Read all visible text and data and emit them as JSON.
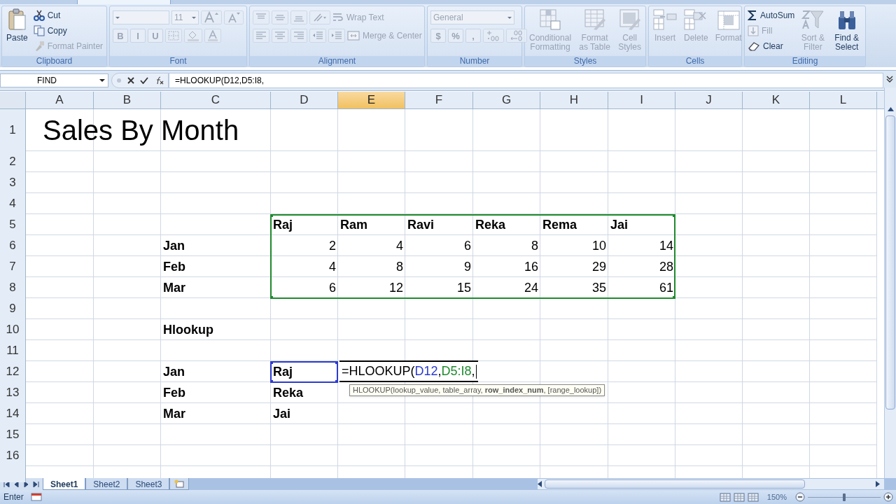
{
  "ribbon": {
    "groups": [
      {
        "label": "Clipboard",
        "lines": [
          [
            {
              "kind": "large",
              "label": "Paste",
              "disabled": false
            }
          ],
          [
            {
              "kind": "small",
              "label": "Cut",
              "disabled": false
            },
            {
              "kind": "small",
              "label": "Copy",
              "disabled": false
            },
            {
              "kind": "small",
              "label": "Format Painter",
              "disabled": true
            }
          ]
        ]
      },
      {
        "label": "Font",
        "lines": [
          [
            {
              "kind": "combo",
              "disabled": true
            },
            {
              "kind": "combo",
              "value": "11",
              "disabled": true
            },
            {
              "kind": "icon",
              "disabled": true
            },
            {
              "kind": "icon",
              "disabled": true
            }
          ],
          [
            {
              "kind": "glyph",
              "label": "B",
              "disabled": true
            },
            {
              "kind": "glyph",
              "label": "I",
              "disabled": true
            },
            {
              "kind": "glyph",
              "label": "U",
              "disabled": true
            },
            {
              "kind": "icon",
              "disabled": true
            },
            {
              "kind": "icon",
              "disabled": true
            },
            {
              "kind": "icon",
              "disabled": true
            }
          ]
        ]
      },
      {
        "label": "Alignment",
        "lines": [
          [
            {
              "kind": "icon",
              "disabled": true
            },
            {
              "kind": "icon",
              "disabled": true
            },
            {
              "kind": "icon",
              "disabled": true
            },
            {
              "kind": "icon",
              "disabled": true
            },
            {
              "kind": "small",
              "label": "Wrap Text",
              "disabled": true
            }
          ],
          [
            {
              "kind": "icon",
              "disabled": true
            },
            {
              "kind": "icon",
              "disabled": true
            },
            {
              "kind": "icon",
              "disabled": true
            },
            {
              "kind": "icon",
              "disabled": true
            },
            {
              "kind": "icon",
              "disabled": true
            },
            {
              "kind": "small",
              "label": "Merge & Center",
              "disabled": true
            }
          ]
        ]
      },
      {
        "label": "Number",
        "lines": [
          [
            {
              "kind": "combo",
              "value": "General",
              "disabled": true
            }
          ],
          [
            {
              "kind": "glyph",
              "label": "$",
              "disabled": true
            },
            {
              "kind": "glyph",
              "label": "%",
              "disabled": true
            },
            {
              "kind": "glyph",
              "label": ",",
              "disabled": true
            },
            {
              "kind": "icon",
              "disabled": true
            },
            {
              "kind": "icon",
              "disabled": true
            }
          ]
        ]
      },
      {
        "label": "Styles",
        "lines": [
          [
            {
              "kind": "large",
              "label": "Conditional Formatting",
              "disabled": true
            }
          ],
          [
            {
              "kind": "large",
              "label": "Format as Table",
              "disabled": true
            }
          ],
          [
            {
              "kind": "large",
              "label": "Cell Styles",
              "disabled": true
            }
          ]
        ]
      },
      {
        "label": "Cells",
        "lines": [
          [
            {
              "kind": "large",
              "label": "Insert",
              "disabled": true
            }
          ],
          [
            {
              "kind": "large",
              "label": "Delete",
              "disabled": true
            }
          ],
          [
            {
              "kind": "large",
              "label": "Format",
              "disabled": true
            }
          ]
        ]
      },
      {
        "label": "Editing",
        "lines": [
          [
            {
              "kind": "small",
              "label": "AutoSum",
              "disabled": false
            },
            {
              "kind": "small",
              "label": "Fill",
              "disabled": true
            },
            {
              "kind": "small",
              "label": "Clear",
              "disabled": false
            }
          ],
          [
            {
              "kind": "large",
              "label": "Sort & Filter",
              "disabled": true
            }
          ],
          [
            {
              "kind": "large",
              "label": "Find & Select",
              "disabled": false
            }
          ]
        ]
      }
    ]
  },
  "formula_bar": {
    "name_box": "FIND",
    "formula": "=HLOOKUP(D12,D5:I8,"
  },
  "columns": [
    {
      "label": "A",
      "selected": false
    },
    {
      "label": "B",
      "selected": false
    },
    {
      "label": "C",
      "selected": false
    },
    {
      "label": "D",
      "selected": false
    },
    {
      "label": "E",
      "selected": true
    },
    {
      "label": "F",
      "selected": false
    },
    {
      "label": "G",
      "selected": false
    },
    {
      "label": "H",
      "selected": false
    },
    {
      "label": "I",
      "selected": false
    },
    {
      "label": "J",
      "selected": false
    },
    {
      "label": "K",
      "selected": false
    },
    {
      "label": "L",
      "selected": false
    }
  ],
  "rows": [
    {
      "number": "1",
      "cells": [
        {
          "kind": "title",
          "text": "Sales By Month"
        }
      ]
    },
    {
      "number": "2"
    },
    {
      "number": "3"
    },
    {
      "number": "4"
    },
    {
      "number": "5",
      "cells": [
        {},
        {},
        {},
        {
          "kind": "label",
          "text": "Raj"
        },
        {
          "kind": "label",
          "text": "Ram"
        },
        {
          "kind": "label",
          "text": "Ravi"
        },
        {
          "kind": "label",
          "text": "Reka"
        },
        {
          "kind": "label",
          "text": "Rema"
        },
        {
          "kind": "label",
          "text": "Jai"
        }
      ]
    },
    {
      "number": "6",
      "cells": [
        {},
        {},
        {
          "kind": "label",
          "text": "Jan"
        },
        {
          "kind": "number",
          "text": "2"
        },
        {
          "kind": "number",
          "text": "4"
        },
        {
          "kind": "number",
          "text": "6"
        },
        {
          "kind": "number",
          "text": "8"
        },
        {
          "kind": "number",
          "text": "10"
        },
        {
          "kind": "number",
          "text": "14"
        }
      ]
    },
    {
      "number": "7",
      "cells": [
        {},
        {},
        {
          "kind": "label",
          "text": "Feb"
        },
        {
          "kind": "number",
          "text": "4"
        },
        {
          "kind": "number",
          "text": "8"
        },
        {
          "kind": "number",
          "text": "9"
        },
        {
          "kind": "number",
          "text": "16"
        },
        {
          "kind": "number",
          "text": "29"
        },
        {
          "kind": "number",
          "text": "28"
        }
      ]
    },
    {
      "number": "8",
      "cells": [
        {},
        {},
        {
          "kind": "label",
          "text": "Mar"
        },
        {
          "kind": "number",
          "text": "6"
        },
        {
          "kind": "number",
          "text": "12"
        },
        {
          "kind": "number",
          "text": "15"
        },
        {
          "kind": "number",
          "text": "24"
        },
        {
          "kind": "number",
          "text": "35"
        },
        {
          "kind": "number",
          "text": "61"
        }
      ]
    },
    {
      "number": "9"
    },
    {
      "number": "10",
      "cells": [
        {},
        {},
        {
          "kind": "label",
          "text": "Hlookup"
        }
      ]
    },
    {
      "number": "11"
    },
    {
      "number": "12",
      "cells": [
        {},
        {},
        {
          "kind": "label",
          "text": "Jan"
        },
        {
          "kind": "label",
          "text": "Raj"
        }
      ]
    },
    {
      "number": "13",
      "cells": [
        {},
        {},
        {
          "kind": "label",
          "text": "Feb"
        },
        {
          "kind": "label",
          "text": "Reka"
        }
      ]
    },
    {
      "number": "14",
      "cells": [
        {},
        {},
        {
          "kind": "label",
          "text": "Mar"
        },
        {
          "kind": "label",
          "text": "Jai"
        }
      ]
    },
    {
      "number": "15"
    },
    {
      "number": "16"
    }
  ],
  "edit_cell": {
    "parts": [
      {
        "kind": "text",
        "text": "=HLOOKUP("
      },
      {
        "kind": "reference",
        "text": "D12",
        "color": "#2b3bd0",
        "separator": ","
      },
      {
        "kind": "reference",
        "text": "D5:I8",
        "color": "#1f8a2e",
        "separator": ","
      }
    ],
    "tooltip": "HLOOKUP(lookup_value, table_array, **row_index_num**, [range_lookup])"
  },
  "sheet_tabs": [
    {
      "label": "Sheet1",
      "selected": true
    },
    {
      "label": "Sheet2",
      "selected": false
    },
    {
      "label": "Sheet3",
      "selected": false
    }
  ],
  "status_bar": {
    "mode": "Enter",
    "zoom": "150%",
    "zoom_slider": {
      "level": 0.5
    }
  }
}
